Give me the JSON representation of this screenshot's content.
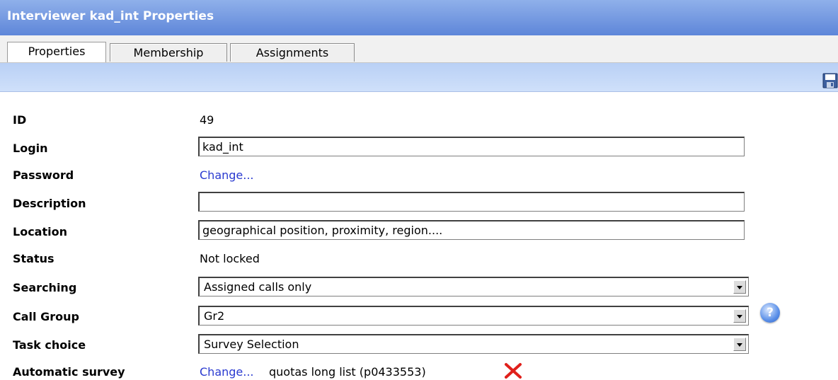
{
  "window": {
    "title": "Interviewer kad_int Properties"
  },
  "tabs": [
    {
      "label": "Properties"
    },
    {
      "label": "Membership"
    },
    {
      "label": "Assignments"
    }
  ],
  "toolbar": {
    "save_icon": "save-icon"
  },
  "form": {
    "id": {
      "label": "ID",
      "value": "49"
    },
    "login": {
      "label": "Login",
      "value": "kad_int"
    },
    "password": {
      "label": "Password",
      "link": "Change..."
    },
    "description": {
      "label": "Description",
      "value": ""
    },
    "location": {
      "label": "Location",
      "value": "geographical position, proximity, region...."
    },
    "status": {
      "label": "Status",
      "value": "Not locked"
    },
    "searching": {
      "label": "Searching",
      "value": "Assigned calls only"
    },
    "call_group": {
      "label": "Call Group",
      "value": "Gr2",
      "help_glyph": "?"
    },
    "task_choice": {
      "label": "Task choice",
      "value": "Survey Selection"
    },
    "automatic_survey": {
      "label": "Automatic survey",
      "link": "Change...",
      "value": "quotas long list (p0433553)"
    }
  },
  "colors": {
    "title_bar": "#6f95df",
    "toolbar": "#c4d8f8",
    "link": "#2a3ad0",
    "remove_x": "#e0201b"
  }
}
